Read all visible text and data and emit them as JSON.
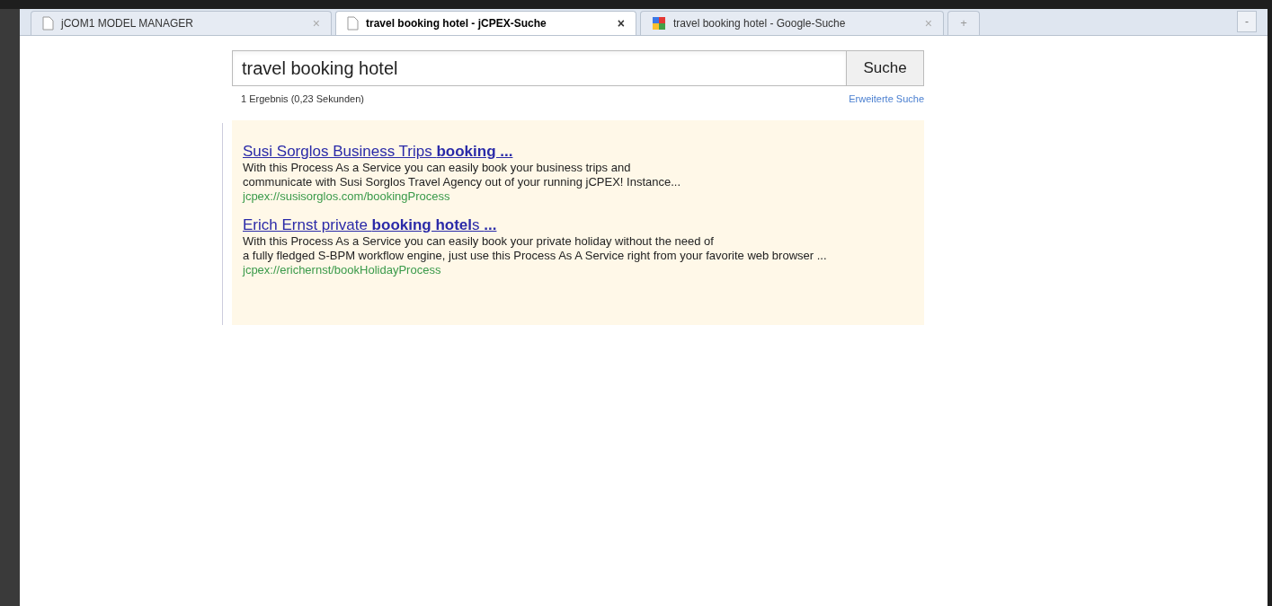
{
  "tabs": [
    {
      "title": "jCOM1 MODEL MANAGER",
      "close": "×",
      "selected": false,
      "kind": "page"
    },
    {
      "title": "travel booking hotel - jCPEX-Suche",
      "close": "×",
      "selected": true,
      "kind": "page"
    },
    {
      "title": "travel booking hotel - Google-Suche",
      "close": "×",
      "selected": false,
      "kind": "google"
    }
  ],
  "new_tab": "+",
  "minimize": "-",
  "search": {
    "value": "travel booking hotel",
    "button": "Suche"
  },
  "result_stats": "1 Ergebnis (0,23 Sekunden)",
  "advanced_search": "Erweiterte Suche",
  "results": [
    {
      "title": "Susi Sorglos Business Trips **booking ...**",
      "description_lines": [
        "With this Process As a Service you can easily book your business trips and",
        "communicate with Susi Sorglos Travel Agency out of your running jCPEX! Instance..."
      ],
      "url": "jcpex://susisorglos.com/bookingProcess"
    },
    {
      "title": "Erich Ernst private **booking hotel**s **...**",
      "description_lines": [
        "With this Process As a Service you can easily book your private holiday without the need of",
        "a fully fledged S-BPM workflow engine, just use this Process As A Service right from your favorite web browser ..."
      ],
      "url": "jcpex://erichernst/bookHolidayProcess"
    }
  ]
}
